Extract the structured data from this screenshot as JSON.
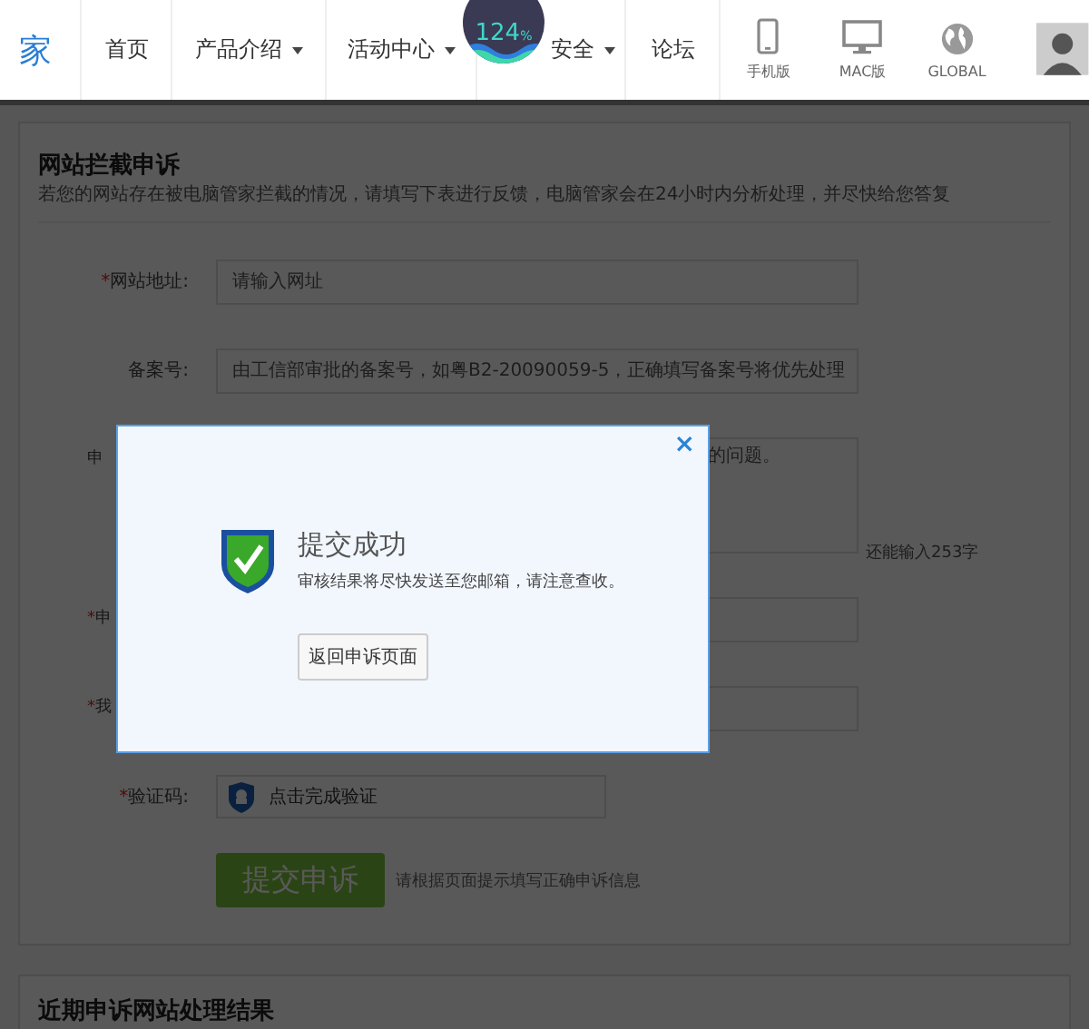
{
  "header": {
    "logo_text": "家",
    "nav": [
      {
        "label": "首页",
        "dropdown": false
      },
      {
        "label": "产品介绍",
        "dropdown": true
      },
      {
        "label": "活动中心",
        "dropdown": true
      },
      {
        "label": "安全",
        "dropdown": true
      },
      {
        "label": "论坛",
        "dropdown": false
      }
    ],
    "platforms": [
      {
        "kind": "phone",
        "label": "手机版"
      },
      {
        "kind": "desktop",
        "label": "MAC版"
      },
      {
        "kind": "globe",
        "label": "GLOBAL"
      }
    ],
    "badge": {
      "value": "124",
      "unit": "%"
    }
  },
  "form": {
    "title": "网站拦截申诉",
    "subtitle": "若您的网站存在被电脑管家拦截的情况，请填写下表进行反馈，电脑管家会在24小时内分析处理，并尽快给您答复",
    "fields": [
      {
        "kind": "input",
        "mark": "*",
        "label": "网站地址:",
        "placeholder": "请输入网址"
      },
      {
        "kind": "input",
        "label": "备案号:",
        "placeholder": "由工信部审批的备案号，如粤B2-20090059-5，正确填写备案号将优先处理"
      },
      {
        "kind": "textarea",
        "label": "申",
        "placeholder": "的问题。",
        "counter": "还能输入253字"
      },
      {
        "kind": "input",
        "mark": "*",
        "label": "申"
      },
      {
        "kind": "input",
        "mark": "*",
        "label": "我"
      },
      {
        "kind": "captcha",
        "mark": "*",
        "label": "验证码:",
        "value": "点击完成验证"
      }
    ],
    "submit": "提交申诉",
    "hint": "请根据页面提示填写正确申诉信息"
  },
  "results": {
    "title": "近期申诉网站处理结果"
  },
  "dialog": {
    "title": "提交成功",
    "message": "审核结果将尽快发送至您邮箱，请注意查收。",
    "button": "返回申诉页面",
    "close": "×"
  }
}
